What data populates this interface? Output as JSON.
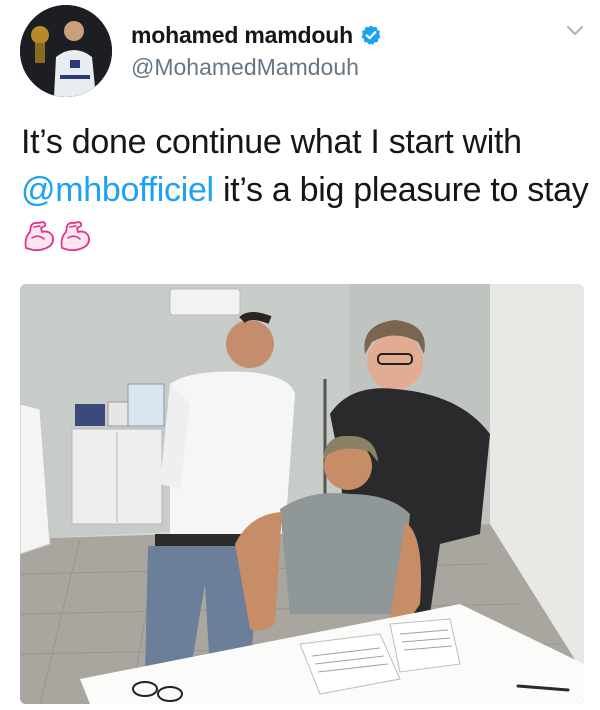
{
  "user": {
    "display_name": "mohamed mamdouh",
    "handle": "@MohamedMamdouh",
    "verified": true,
    "avatar_icon": "profile-photo"
  },
  "tweet": {
    "text_part1": "It’s done continue what I start with ",
    "mention": "@mhbofficiel",
    "text_part2": " it’s a big pleasure to stay ",
    "emojis": [
      "flexed-biceps",
      "flexed-biceps"
    ],
    "media_description_icon": "photo"
  },
  "colors": {
    "link": "#1da1f2",
    "verified_badge": "#1da1f2",
    "handle": "#657786",
    "emoji_outline": "#e0368a"
  }
}
